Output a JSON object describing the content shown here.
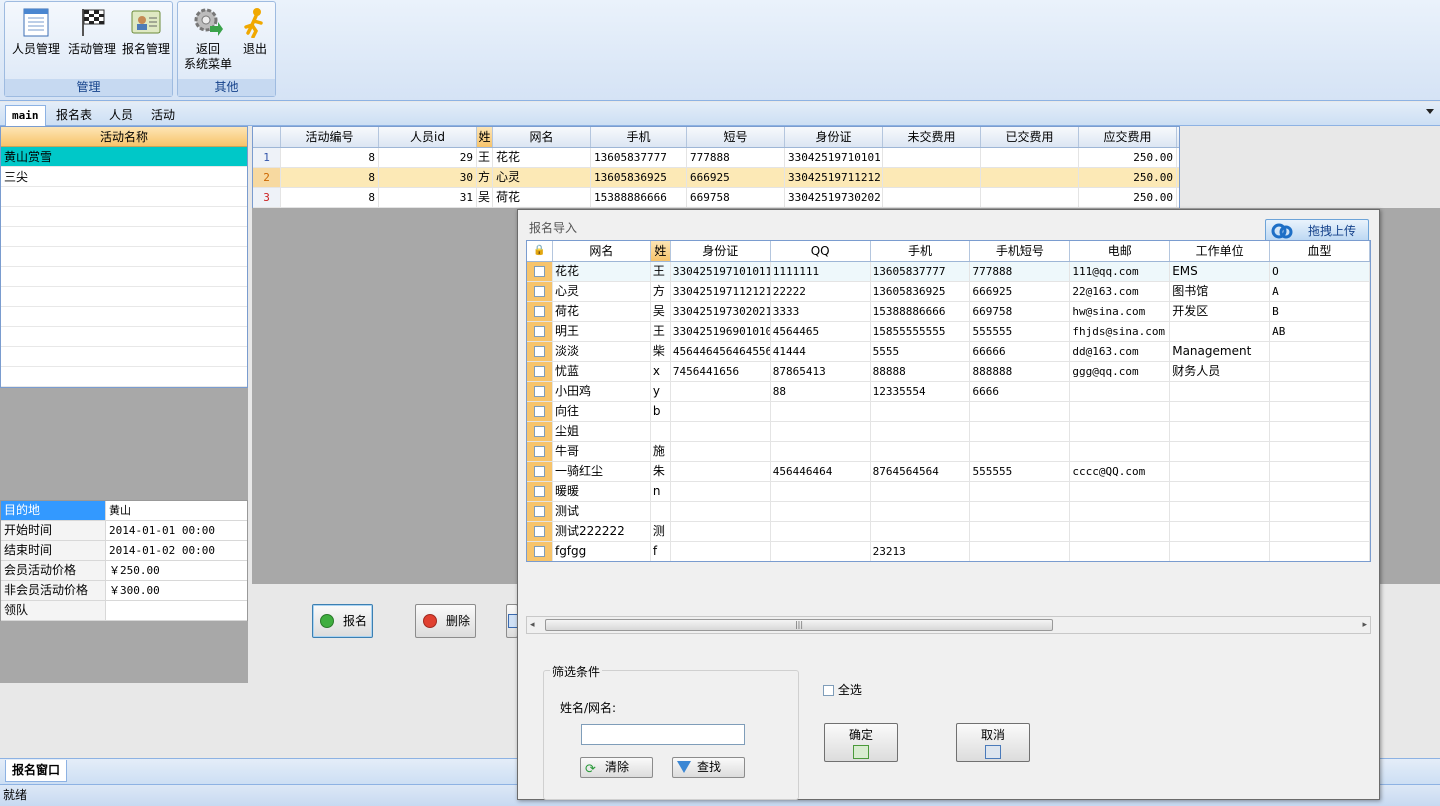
{
  "ribbon": {
    "groups": [
      {
        "title": "管理"
      },
      {
        "title": "其他"
      }
    ],
    "buttons": [
      {
        "label": "人员管理",
        "icon": "person-list-icon"
      },
      {
        "label": "活动管理",
        "icon": "checkered-flag-icon"
      },
      {
        "label": "报名管理",
        "icon": "registration-card-icon"
      },
      {
        "label1": "返回",
        "label2": "系统菜单",
        "icon": "gear-arrow-icon"
      },
      {
        "label": "退出",
        "icon": "running-man-icon"
      }
    ]
  },
  "tabs": [
    {
      "label": "main"
    },
    {
      "label": "报名表"
    },
    {
      "label": "人员"
    },
    {
      "label": "活动"
    }
  ],
  "activity_list": {
    "header": "活动名称",
    "items": [
      "黄山赏雪",
      "三尖"
    ]
  },
  "props": [
    {
      "k": "目的地",
      "v": "黄山"
    },
    {
      "k": "开始时间",
      "v": "2014-01-01 00:00"
    },
    {
      "k": "结束时间",
      "v": "2014-01-02 00:00"
    },
    {
      "k": "会员活动价格",
      "v": "￥250.00"
    },
    {
      "k": "非会员活动价格",
      "v": "￥300.00"
    },
    {
      "k": "领队",
      "v": ""
    }
  ],
  "topgrid": {
    "headers": [
      "活动编号",
      "人员id",
      "姓",
      "网名",
      "手机",
      "短号",
      "身份证",
      "未交费用",
      "已交费用",
      "应交费用"
    ],
    "rows": [
      {
        "n": "1",
        "c": [
          "8",
          "29",
          "王",
          "花花",
          "13605837777",
          "777888",
          "33042519710101",
          "",
          "",
          "250.00"
        ]
      },
      {
        "n": "2",
        "c": [
          "8",
          "30",
          "方",
          "心灵",
          "13605836925",
          "666925",
          "33042519711212",
          "",
          "",
          "250.00"
        ]
      },
      {
        "n": "3",
        "c": [
          "8",
          "31",
          "吴",
          "荷花",
          "15388886666",
          "669758",
          "33042519730202",
          "",
          "",
          "250.00"
        ]
      }
    ]
  },
  "actions": {
    "signup": "报名",
    "delete": "删除"
  },
  "bottom_tab": "报名窗口",
  "status": "就绪",
  "dialog": {
    "title": "报名导入",
    "upload": "拖拽上传",
    "headers": [
      "网名",
      "姓",
      "身份证",
      "QQ",
      "手机",
      "手机短号",
      "电邮",
      "工作单位",
      "血型"
    ],
    "rows": [
      [
        "花花",
        "王",
        "330425197101011",
        "1111111",
        "13605837777",
        "777888",
        "111@qq.com",
        "EMS",
        "O"
      ],
      [
        "心灵",
        "方",
        "330425197112121",
        "22222",
        "13605836925",
        "666925",
        "22@163.com",
        "图书馆",
        "A"
      ],
      [
        "荷花",
        "吴",
        "330425197302021",
        "3333",
        "15388886666",
        "669758",
        "hw@sina.com",
        "开发区",
        "B"
      ],
      [
        "明王",
        "王",
        "330425196901010",
        "4564465",
        "15855555555",
        "555555",
        "fhjds@sina.com",
        "",
        "AB"
      ],
      [
        "淡淡",
        "柴",
        "456446456464556",
        "41444",
        "5555",
        "66666",
        "dd@163.com",
        "Management",
        ""
      ],
      [
        "忧蓝",
        "x",
        "7456441656",
        "87865413",
        "88888",
        "888888",
        "ggg@qq.com",
        "财务人员",
        ""
      ],
      [
        "小田鸡",
        "y",
        "",
        "88",
        "12335554",
        "6666",
        "",
        "",
        ""
      ],
      [
        "向往",
        "b",
        "",
        "",
        "",
        "",
        "",
        "",
        ""
      ],
      [
        "尘姐",
        "",
        "",
        "",
        "",
        "",
        "",
        "",
        ""
      ],
      [
        "牛哥",
        "施",
        "",
        "",
        "",
        "",
        "",
        "",
        ""
      ],
      [
        "一骑红尘",
        "朱",
        "",
        "456446464",
        "8764564564",
        "555555",
        "cccc@QQ.com",
        "",
        ""
      ],
      [
        "暖暖",
        "n",
        "",
        "",
        "",
        "",
        "",
        "",
        ""
      ],
      [
        "测试",
        "",
        "",
        "",
        "",
        "",
        "",
        "",
        ""
      ],
      [
        "测试222222",
        "测",
        "",
        "",
        "",
        "",
        "",
        "",
        ""
      ],
      [
        "fgfgg",
        "f",
        "",
        "",
        "23213",
        "",
        "",
        "",
        ""
      ]
    ],
    "filter": {
      "legend": "筛选条件",
      "label": "姓名/网名:",
      "value": "",
      "clear": "清除",
      "find": "查找"
    },
    "select_all": "全选",
    "ok": "确定",
    "cancel": "取消"
  }
}
